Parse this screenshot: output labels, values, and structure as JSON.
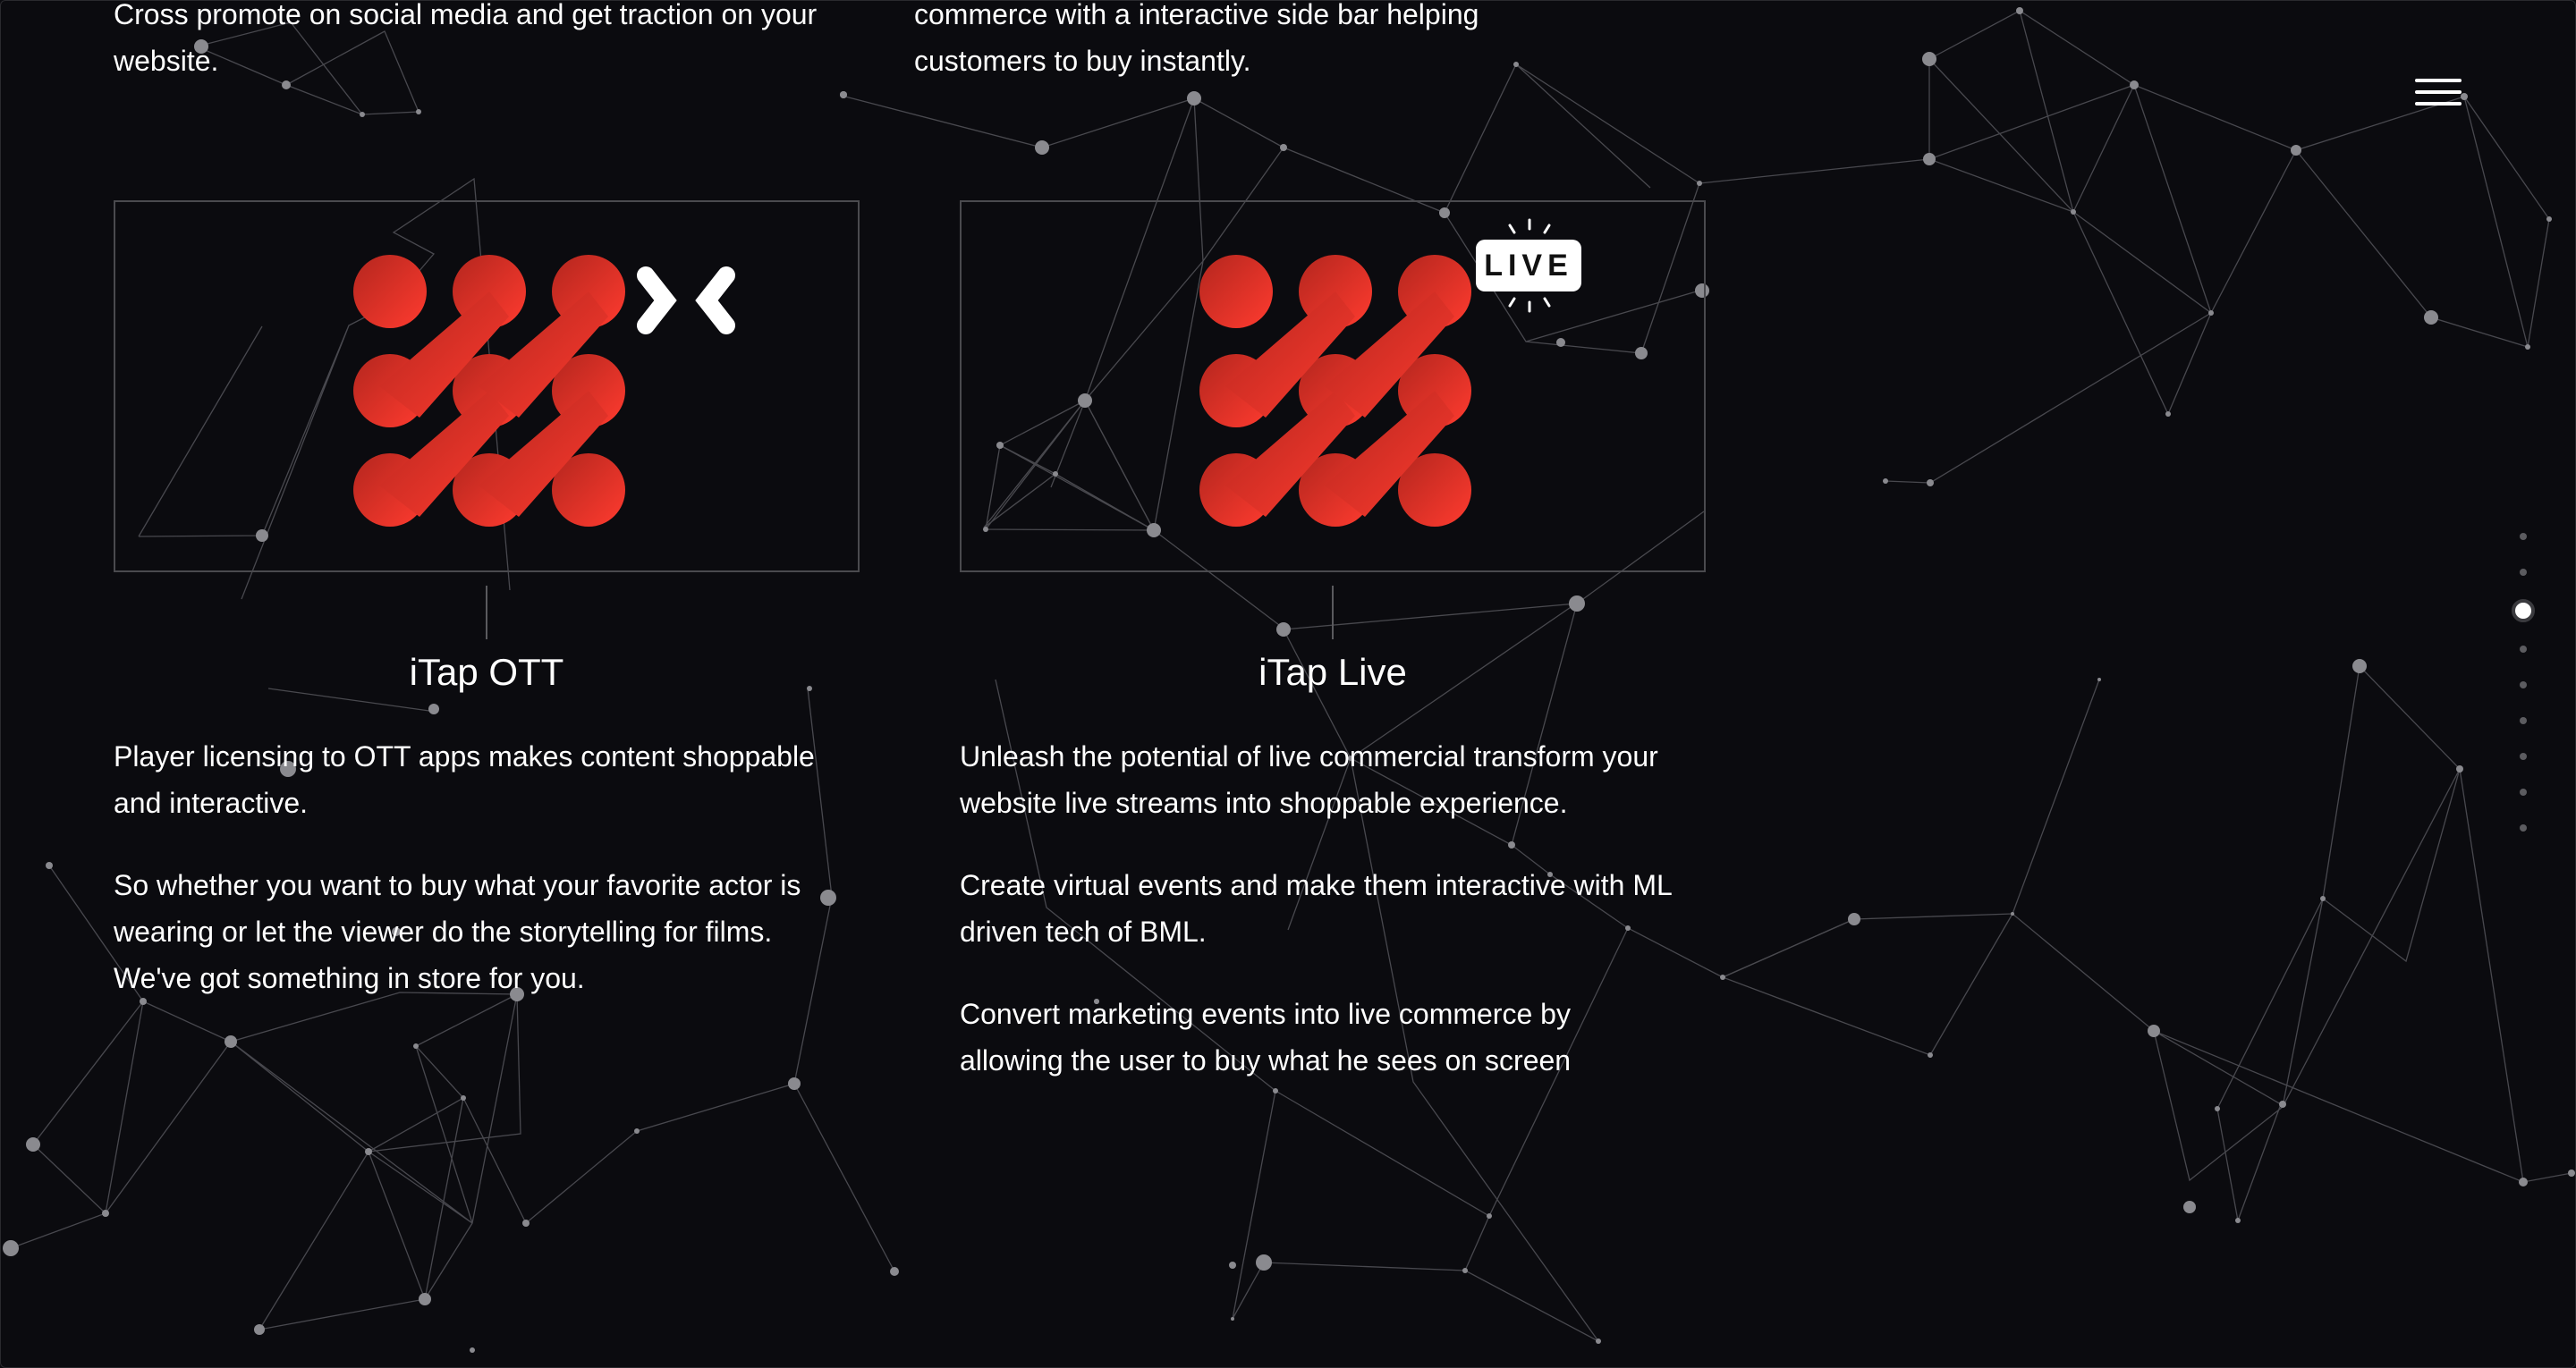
{
  "top_texts": {
    "left": [
      "Cross promote on social media and get traction on your",
      "website."
    ],
    "right": [
      "commerce with a interactive side bar helping",
      "customers to buy instantly."
    ]
  },
  "products": [
    {
      "title": "iTap OTT",
      "paragraphs": [
        [
          "Player licensing to OTT apps makes content shoppable",
          "and interactive."
        ],
        [
          "So whether you want to buy what your favorite actor is",
          "wearing or let the viewer do the storytelling for films.",
          "We've got something in store for you."
        ]
      ],
      "badge_icon": "mx-logo-icon"
    },
    {
      "title": "iTap Live",
      "paragraphs": [
        [
          "Unleash the potential of live commercial transform your",
          "website live streams into shoppable experience."
        ],
        [
          "Create virtual events and make them interactive with ML",
          "driven tech of BML."
        ],
        [
          "Convert marketing events into live commerce by",
          "allowing the user to buy what he sees on screen"
        ]
      ],
      "badge_text": "LIVE"
    }
  ],
  "menu_icon": "hamburger-menu-icon",
  "section_nav": {
    "count": 9,
    "active_index": 2
  },
  "colors": {
    "background": "#0b0b0f",
    "brand_red_dark": "#b3261e",
    "brand_red_light": "#ff3b2f",
    "text": "#ffffff",
    "network_lines": "#6b6b70"
  }
}
